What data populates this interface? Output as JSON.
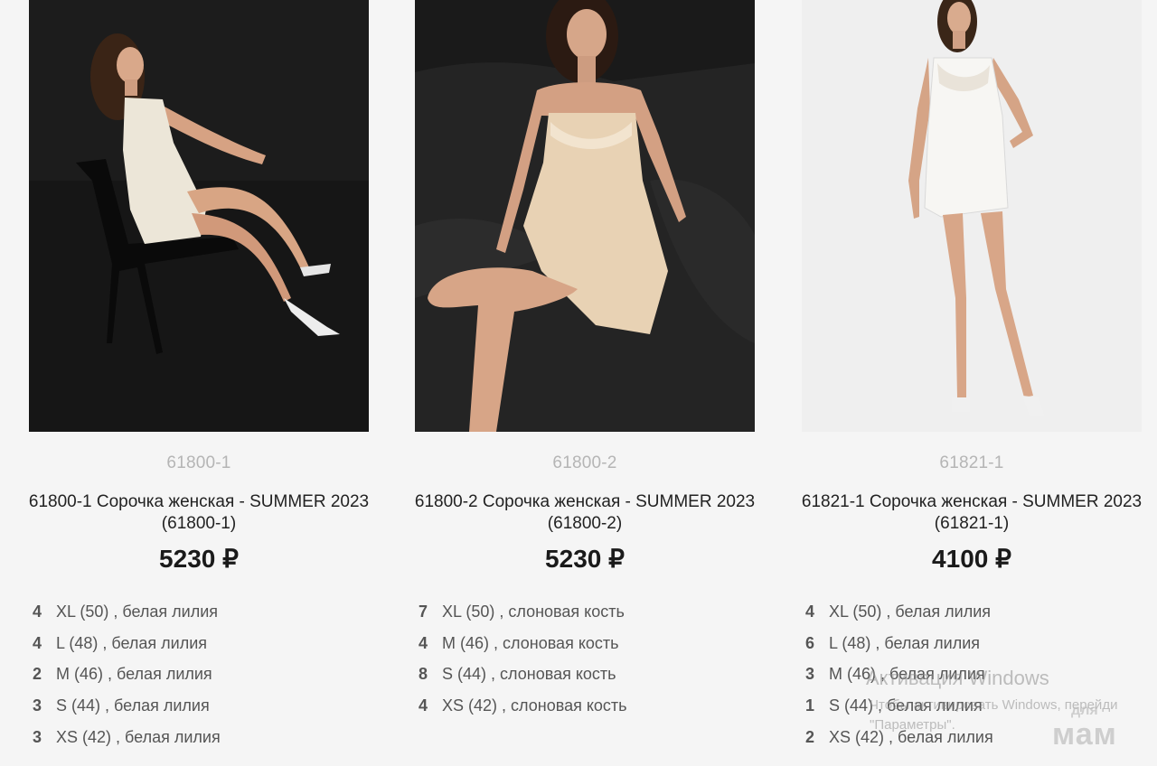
{
  "products": [
    {
      "article": "61800-1",
      "title": "61800-1 Сорочка женская - SUMMER 2023 (61800-1)",
      "price": "5230 ₽",
      "stock": [
        {
          "qty": "4",
          "size": "XL (50)",
          "color": "белая лилия"
        },
        {
          "qty": "4",
          "size": "L (48)",
          "color": "белая лилия"
        },
        {
          "qty": "2",
          "size": "M (46)",
          "color": "белая лилия"
        },
        {
          "qty": "3",
          "size": "S (44)",
          "color": "белая лилия"
        },
        {
          "qty": "3",
          "size": "XS (42)",
          "color": "белая лилия"
        }
      ]
    },
    {
      "article": "61800-2",
      "title": "61800-2 Сорочка женская - SUMMER 2023 (61800-2)",
      "price": "5230 ₽",
      "stock": [
        {
          "qty": "7",
          "size": "XL (50)",
          "color": "слоновая кость"
        },
        {
          "qty": "4",
          "size": "M (46)",
          "color": "слоновая кость"
        },
        {
          "qty": "8",
          "size": "S (44)",
          "color": "слоновая кость"
        },
        {
          "qty": "4",
          "size": "XS (42)",
          "color": "слоновая кость"
        }
      ]
    },
    {
      "article": "61821-1",
      "title": "61821-1 Сорочка женская - SUMMER 2023 (61821-1)",
      "price": "4100 ₽",
      "stock": [
        {
          "qty": "4",
          "size": "XL (50)",
          "color": "белая лилия"
        },
        {
          "qty": "6",
          "size": "L (48)",
          "color": "белая лилия"
        },
        {
          "qty": "3",
          "size": "M (46)",
          "color": "белая лилия"
        },
        {
          "qty": "1",
          "size": "S (44)",
          "color": "белая лилия"
        },
        {
          "qty": "2",
          "size": "XS (42)",
          "color": "белая лилия"
        }
      ]
    }
  ],
  "watermark": {
    "title": "Активация Windows",
    "line1": "Чтобы активировать Windows, перейди",
    "line2": "\"Параметры\"."
  },
  "logo": {
    "top": "для",
    "bottom": "мам"
  }
}
